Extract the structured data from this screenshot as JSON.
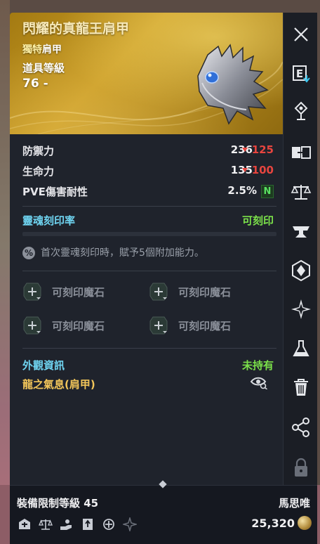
{
  "item": {
    "name": "閃耀的真龍王肩甲",
    "quality": "獨特",
    "slot_type": "肩甲",
    "item_level_label": "道具等級",
    "item_level_value": "76 -"
  },
  "stats": [
    {
      "label": "防禦力",
      "value": "236",
      "diff": "125"
    },
    {
      "label": "生命力",
      "value": "135",
      "diff": "100"
    },
    {
      "label": "PVE傷害耐性",
      "value": "2.5%",
      "badge": "N"
    }
  ],
  "soul": {
    "label": "靈魂刻印率",
    "status": "可刻印",
    "note_icon": "%",
    "note": "首次靈魂刻印時，賦予5個附加能力。"
  },
  "slots": [
    {
      "label": "可刻印魔石"
    },
    {
      "label": "可刻印魔石"
    },
    {
      "label": "可刻印魔石"
    },
    {
      "label": "可刻印魔石"
    }
  ],
  "appearance": {
    "label": "外觀資訊",
    "status": "未持有",
    "name": "龍之氣息(肩甲)"
  },
  "footer": {
    "level_restriction": "裝備限制等級 45",
    "seller": "馬思唯",
    "price": "25,320"
  },
  "sidebar": {
    "icons": [
      "close-icon",
      "equip-compare-icon",
      "pin-icon",
      "swap-icon",
      "scale-icon",
      "anvil-icon",
      "enchant-icon",
      "sparkle-icon",
      "flask-icon",
      "trash-icon",
      "share-icon",
      "lock-icon"
    ],
    "equip_letter": "E"
  },
  "colors": {
    "accent_cyan": "#6fd4f1",
    "positive_green": "#7be04a",
    "negative_red": "#e7453f",
    "gold": "#f3c65a"
  }
}
